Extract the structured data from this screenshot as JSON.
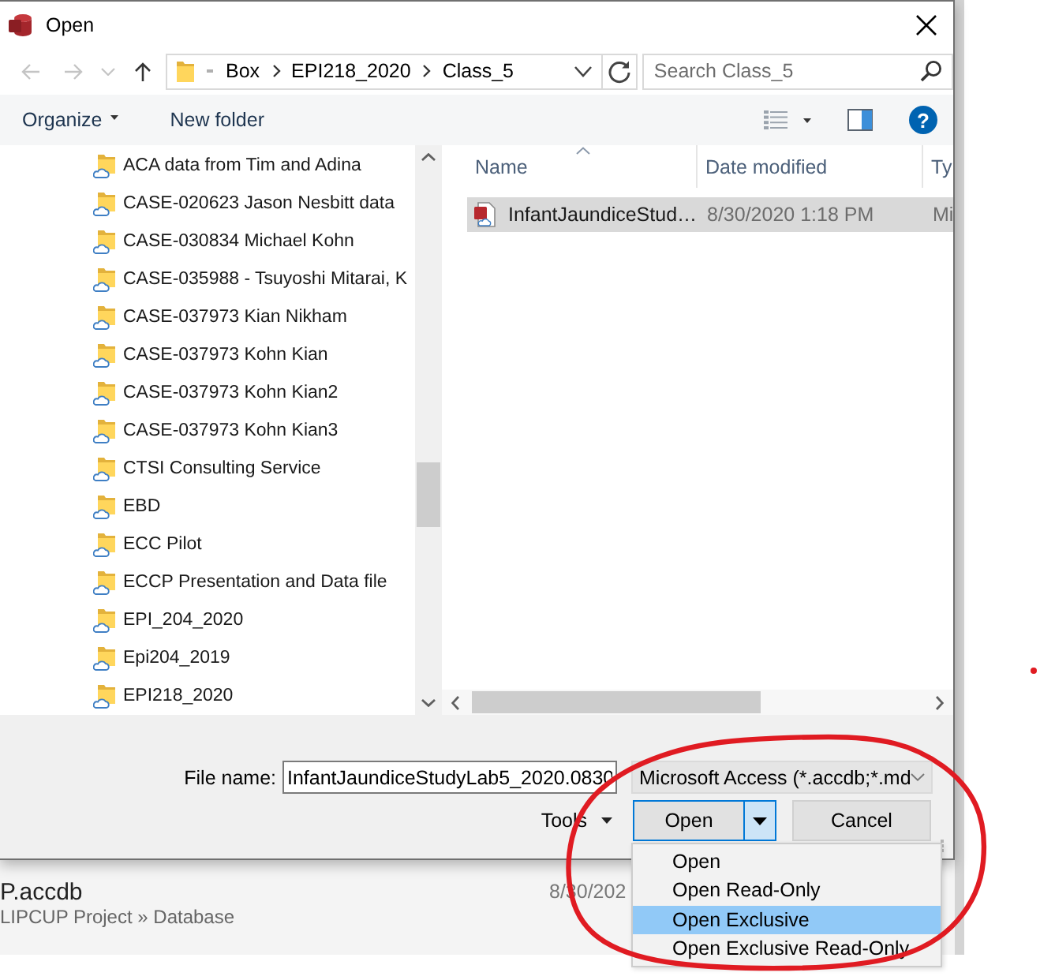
{
  "window": {
    "title": "Open"
  },
  "address_bar": {
    "nav_buttons": [
      {
        "kind": "back",
        "disabled": true
      },
      {
        "kind": "forward",
        "disabled": true
      },
      {
        "kind": "recent",
        "disabled": true
      },
      {
        "kind": "up",
        "disabled": false
      }
    ],
    "path": [
      "Box",
      "EPI218_2020",
      "Class_5"
    ]
  },
  "search": {
    "placeholder": "Search Class_5"
  },
  "toolbar": {
    "organize": "Organize",
    "new_folder": "New folder",
    "help": "?"
  },
  "navigation_pane": {
    "items": [
      "ACA data from Tim and Adina",
      "CASE-020623 Jason Nesbitt data",
      "CASE-030834 Michael Kohn",
      "CASE-035988 - Tsuyoshi Mitarai, K",
      "CASE-037973 Kian Nikham",
      "CASE-037973 Kohn Kian",
      "CASE-037973 Kohn Kian2",
      "CASE-037973 Kohn Kian3",
      "CTSI Consulting Service",
      "EBD",
      "ECC Pilot",
      "ECCP Presentation and Data file",
      "EPI_204_2020",
      "Epi204_2019",
      "EPI218_2020"
    ]
  },
  "file_list": {
    "columns": [
      {
        "label": "Name",
        "sorted": true
      },
      {
        "label": "Date modified",
        "sorted": false
      },
      {
        "label": "Ty",
        "sorted": false
      }
    ],
    "rows": [
      {
        "cells": [
          "InfantJaundiceStud…",
          "8/30/2020 1:18 PM",
          "Mi"
        ],
        "selected": true
      }
    ]
  },
  "file_name": {
    "label": "File name:",
    "value": "InfantJaundiceStudyLab5_2020.0830"
  },
  "file_type": {
    "value": "Microsoft Access (*.accdb;*.md"
  },
  "buttons": {
    "tools": "Tools",
    "open": "Open",
    "open_menu_expanded": true,
    "cancel": "Cancel"
  },
  "open_menu": {
    "items": [
      {
        "label": "Open",
        "selected": false
      },
      {
        "label": "Open Read-Only",
        "selected": false
      },
      {
        "label": "Open Exclusive",
        "selected": true
      },
      {
        "label": "Open Exclusive Read-Only",
        "selected": false
      }
    ]
  },
  "background_window": {
    "title": "P.accdb",
    "path": "LIPCUP Project » Database",
    "date": "8/30/202"
  }
}
